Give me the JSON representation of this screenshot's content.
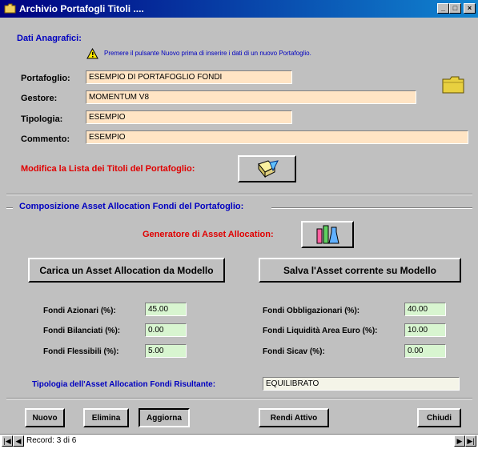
{
  "window": {
    "title": "Archivio Portafogli Titoli ....",
    "minimize": "_",
    "maximize": "□",
    "close": "×"
  },
  "anagrafica": {
    "section_label": "Dati Anagrafici:",
    "warning": "Premere il pulsante Nuovo prima di inserire i dati di un nuovo Portafoglio.",
    "portafoglio_label": "Portafoglio:",
    "portafoglio_value": "ESEMPIO DI PORTAFOGLIO FONDI",
    "gestore_label": "Gestore:",
    "gestore_value": "MOMENTUM V8",
    "tipologia_label": "Tipologia:",
    "tipologia_value": "ESEMPIO",
    "commento_label": "Commento:",
    "commento_value": "ESEMPIO",
    "modifica_label": "Modifica la Lista dei Titoli del Portafoglio:"
  },
  "allocation": {
    "section_label": "Composizione Asset Allocation Fondi del Portafoglio:",
    "generatore_label": "Generatore di Asset Allocation:",
    "carica_button": "Carica un Asset Allocation da Modello",
    "salva_button": "Salva l'Asset corrente su Modello",
    "fields": {
      "azionari_label": "Fondi Azionari (%):",
      "azionari_value": "45.00",
      "bilanciati_label": "Fondi Bilanciati (%):",
      "bilanciati_value": "0.00",
      "flessibili_label": "Fondi Flessibili (%):",
      "flessibili_value": "5.00",
      "obbligazionari_label": "Fondi Obbligazionari (%):",
      "obbligazionari_value": "40.00",
      "liquidita_label": "Fondi Liquidità Area Euro (%):",
      "liquidita_value": "10.00",
      "sicav_label": "Fondi Sicav (%):",
      "sicav_value": "0.00"
    },
    "tipologia_label": "Tipologia dell'Asset Allocation Fondi Risultante:",
    "tipologia_value": "EQUILIBRATO"
  },
  "buttons": {
    "nuovo": "Nuovo",
    "elimina": "Elimina",
    "aggiorna": "Aggiorna",
    "rendi_attivo": "Rendi Attivo",
    "chiudi": "Chiudi"
  },
  "status": {
    "record": "Record: 3 di 6"
  }
}
